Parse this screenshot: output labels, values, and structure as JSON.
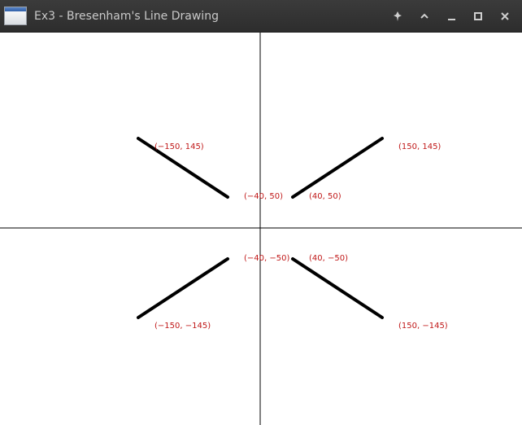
{
  "window": {
    "title": "Ex3 - Bresenham's Line Drawing",
    "icons": {
      "app": "window-app-icon",
      "pin": "pin-icon",
      "shade": "chevron-up-icon",
      "minimize": "minimize-icon",
      "maximize": "maximize-icon",
      "close": "close-icon"
    }
  },
  "colors": {
    "titlebar": "#333333",
    "title_text": "#c9c9c9",
    "line": "#000000",
    "axis": "#000000",
    "label": "#c01818",
    "background": "#ffffff"
  },
  "drawing": {
    "lines": [
      {
        "name": "line-top-left",
        "from": [
          -150,
          145
        ],
        "to": [
          -40,
          50
        ]
      },
      {
        "name": "line-top-right",
        "from": [
          40,
          50
        ],
        "to": [
          150,
          145
        ]
      },
      {
        "name": "line-bottom-left",
        "from": [
          -150,
          -145
        ],
        "to": [
          -40,
          -50
        ]
      },
      {
        "name": "line-bottom-right",
        "from": [
          40,
          -50
        ],
        "to": [
          150,
          -145
        ]
      }
    ],
    "labels": [
      {
        "name": "label-m150-145",
        "text": "(−150, 145)",
        "at": [
          -150,
          145
        ]
      },
      {
        "name": "label-150-145",
        "text": "(150, 145)",
        "at": [
          150,
          145
        ]
      },
      {
        "name": "label-m40-50",
        "text": "(−40, 50)",
        "at": [
          -40,
          50
        ]
      },
      {
        "name": "label-40-50",
        "text": "(40, 50)",
        "at": [
          40,
          50
        ]
      },
      {
        "name": "label-m40-m50",
        "text": "(−40, −50)",
        "at": [
          -40,
          -50
        ]
      },
      {
        "name": "label-40-m50",
        "text": "(40, −50)",
        "at": [
          40,
          -50
        ]
      },
      {
        "name": "label-m150-m145",
        "text": "(−150, −145)",
        "at": [
          -150,
          -145
        ]
      },
      {
        "name": "label-150-m145",
        "text": "(150, −145)",
        "at": [
          150,
          -145
        ]
      }
    ]
  }
}
